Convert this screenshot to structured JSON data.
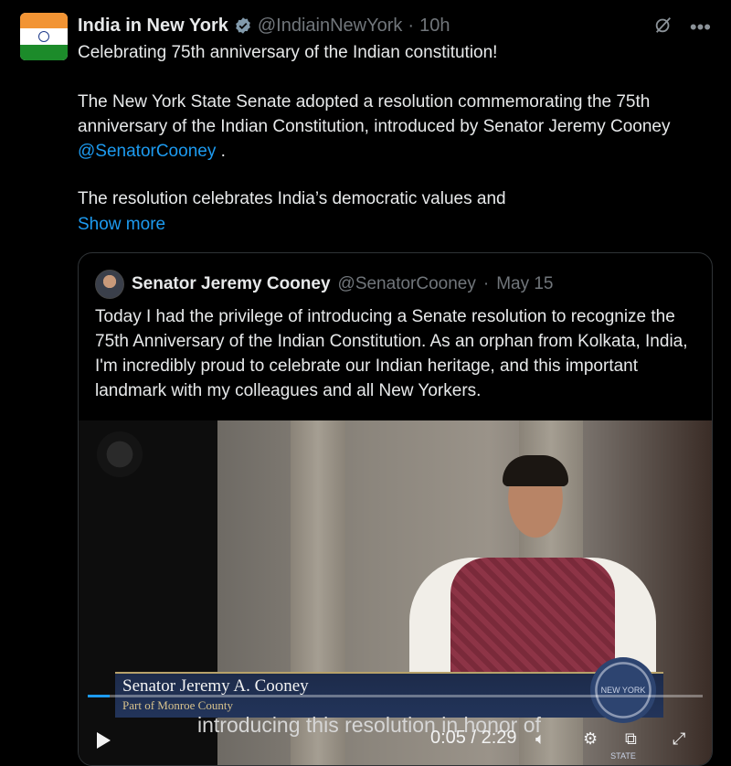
{
  "tweet": {
    "display_name": "India in New York",
    "handle": "@IndiainNewYork",
    "separator": "·",
    "time": "10h",
    "line1": "Celebrating 75th anniversary of the Indian constitution!",
    "para2_part1": "The New York State Senate adopted a resolution commemorating the 75th anniversary of the Indian Constitution, introduced by Senator Jeremy Cooney ",
    "para2_mention": "@SenatorCooney",
    "para2_end": " .",
    "para3": "The resolution celebrates India’s democratic values and",
    "show_more": "Show more",
    "icons": [
      "grok-icon",
      "more-icon"
    ]
  },
  "quote": {
    "display_name": "Senator Jeremy Cooney",
    "handle": "@SenatorCooney",
    "separator": "·",
    "date": "May 15",
    "text": "Today I had the privilege of introducing a Senate resolution to recognize the 75th Anniversary of the Indian Constitution. As an orphan from Kolkata, India, I'm incredibly proud to celebrate our Indian heritage, and this important landmark with my colleagues and all New Yorkers."
  },
  "video": {
    "lower_third_name": "Senator Jeremy A. Cooney",
    "lower_third_sub": "Part of Monroe County",
    "seal_text": "NEW YORK STATE",
    "caption": "introducing this resolution in honor of",
    "time_display": "0:05 / 2:29",
    "progress": 0.035,
    "accent": "#1d9bf0",
    "icons": [
      "play-icon",
      "mute-icon",
      "settings-icon",
      "pip-icon",
      "fullscreen-icon"
    ]
  },
  "colors": {
    "background": "#000000",
    "text": "#e7e9ea",
    "muted": "#71767b",
    "link": "#1d9bf0",
    "border": "#2f3336"
  }
}
